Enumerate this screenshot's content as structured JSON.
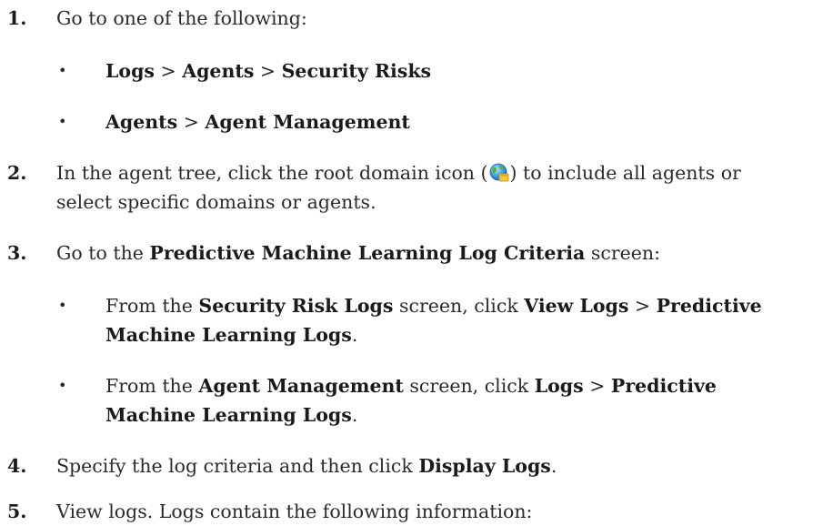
{
  "steps": [
    {
      "number": "1.",
      "text": "Go to one of the following:",
      "bullets": [
        {
          "parts": [
            {
              "b": "Logs"
            },
            {
              "t": " > "
            },
            {
              "b": "Agents"
            },
            {
              "t": " > "
            },
            {
              "b": "Security Risks"
            }
          ]
        },
        {
          "parts": [
            {
              "b": "Agents"
            },
            {
              "t": " > "
            },
            {
              "b": "Agent Management"
            }
          ]
        }
      ]
    },
    {
      "number": "2.",
      "text_before_icon": "In the agent tree, click the root domain icon (",
      "icon": "root-domain-globe-icon",
      "text_after_icon": ") to include all agents or",
      "text_line2": "select specific domains or agents."
    },
    {
      "number": "3.",
      "parts": [
        {
          "t": "Go to the "
        },
        {
          "b": "Predictive Machine Learning Log Criteria"
        },
        {
          "t": " screen:"
        }
      ],
      "bullets": [
        {
          "line1": [
            {
              "t": "From the "
            },
            {
              "b": "Security Risk Logs"
            },
            {
              "t": " screen, click "
            },
            {
              "b": "View Logs"
            },
            {
              "t": " > "
            },
            {
              "b": "Predictive"
            }
          ],
          "line2": [
            {
              "b": "Machine Learning Logs"
            },
            {
              "t": "."
            }
          ]
        },
        {
          "line1": [
            {
              "t": "From the "
            },
            {
              "b": "Agent Management"
            },
            {
              "t": " screen, click "
            },
            {
              "b": "Logs"
            },
            {
              "t": " > "
            },
            {
              "b": "Predictive"
            }
          ],
          "line2": [
            {
              "b": "Machine Learning Logs"
            },
            {
              "t": "."
            }
          ]
        }
      ]
    },
    {
      "number": "4.",
      "parts": [
        {
          "t": "Specify the log criteria and then click "
        },
        {
          "b": "Display Logs"
        },
        {
          "t": "."
        }
      ]
    },
    {
      "number": "5.",
      "text": "View logs. Logs contain the following information:"
    }
  ]
}
